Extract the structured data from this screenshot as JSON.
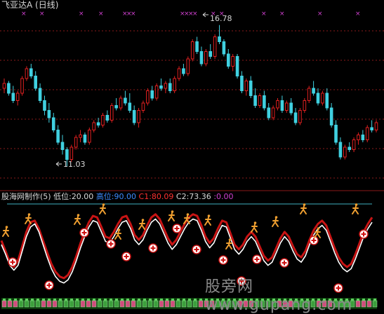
{
  "title": "飞亚达A (日线)",
  "indicator": {
    "name": "股海网制作(5)",
    "items": [
      {
        "label": "低位:",
        "value": "20.00",
        "color": "#d8d8d8"
      },
      {
        "label": "高位:",
        "value": "90.00",
        "color": "#3c8cff"
      },
      {
        "label": "C1:",
        "value": "80.09",
        "color": "#ff3030"
      },
      {
        "label": "C2:",
        "value": "73.36",
        "color": "#d8d8d8"
      },
      {
        "label": ":",
        "value": "0.00",
        "color": "#d040d0"
      }
    ]
  },
  "annotations": {
    "high": "16.78",
    "low": "11.03"
  },
  "watermark": "股旁网 www.gupang.com",
  "colors": {
    "background": "#000000",
    "up": "#e02020",
    "down": "#40d0e0",
    "grid": "#8a1a1a",
    "c1_line": "#c81414",
    "c2_line": "#ffffff",
    "marker": "#d040d0",
    "hline": "#40b0c0"
  },
  "chart_data": {
    "type": "candlestick",
    "price_high": 16.78,
    "price_low": 11.03,
    "candles": [
      [
        14.2,
        14.6,
        14.0,
        14.4
      ],
      [
        14.4,
        14.5,
        13.9,
        14.0
      ],
      [
        14.0,
        14.3,
        13.6,
        13.7
      ],
      [
        13.7,
        14.1,
        13.5,
        14.0
      ],
      [
        14.0,
        14.7,
        13.9,
        14.6
      ],
      [
        14.6,
        15.1,
        14.5,
        15.0
      ],
      [
        15.0,
        15.2,
        14.6,
        14.7
      ],
      [
        14.7,
        14.9,
        14.1,
        14.2
      ],
      [
        14.2,
        14.4,
        13.6,
        13.7
      ],
      [
        13.7,
        13.9,
        13.1,
        13.3
      ],
      [
        13.3,
        13.6,
        12.8,
        13.0
      ],
      [
        13.0,
        13.2,
        12.4,
        12.5
      ],
      [
        12.5,
        12.7,
        11.9,
        12.0
      ],
      [
        12.0,
        12.3,
        11.5,
        11.7
      ],
      [
        11.7,
        11.8,
        11.03,
        11.3
      ],
      [
        11.3,
        11.9,
        11.2,
        11.8
      ],
      [
        11.8,
        12.3,
        11.7,
        12.2
      ],
      [
        12.2,
        12.5,
        12.0,
        12.3
      ],
      [
        12.3,
        12.4,
        11.9,
        12.0
      ],
      [
        12.0,
        12.6,
        11.9,
        12.5
      ],
      [
        12.5,
        12.9,
        12.4,
        12.8
      ],
      [
        12.8,
        13.0,
        12.6,
        12.7
      ],
      [
        12.7,
        13.2,
        12.6,
        13.1
      ],
      [
        13.1,
        13.3,
        12.8,
        12.9
      ],
      [
        12.9,
        13.6,
        12.8,
        13.5
      ],
      [
        13.5,
        13.8,
        13.3,
        13.4
      ],
      [
        13.4,
        13.9,
        13.3,
        13.8
      ],
      [
        13.8,
        14.1,
        13.5,
        13.6
      ],
      [
        13.6,
        14.0,
        13.2,
        13.3
      ],
      [
        13.3,
        13.5,
        12.7,
        12.8
      ],
      [
        12.8,
        13.4,
        12.6,
        13.3
      ],
      [
        13.3,
        13.7,
        13.2,
        13.6
      ],
      [
        13.6,
        14.2,
        13.5,
        14.1
      ],
      [
        14.1,
        14.3,
        13.7,
        13.8
      ],
      [
        13.8,
        14.4,
        13.7,
        14.3
      ],
      [
        14.3,
        14.6,
        14.1,
        14.2
      ],
      [
        14.2,
        14.5,
        14.0,
        14.4
      ],
      [
        14.4,
        14.6,
        14.0,
        14.1
      ],
      [
        14.1,
        14.7,
        14.0,
        14.6
      ],
      [
        14.6,
        15.1,
        14.5,
        15.0
      ],
      [
        15.0,
        15.2,
        14.7,
        14.8
      ],
      [
        14.8,
        15.5,
        14.7,
        15.4
      ],
      [
        15.4,
        16.2,
        15.3,
        16.1
      ],
      [
        16.1,
        16.3,
        15.6,
        15.7
      ],
      [
        15.7,
        15.9,
        15.1,
        15.2
      ],
      [
        15.2,
        15.8,
        15.1,
        15.7
      ],
      [
        15.7,
        16.0,
        15.4,
        15.5
      ],
      [
        15.5,
        16.4,
        15.4,
        16.3
      ],
      [
        16.3,
        16.78,
        16.0,
        16.1
      ],
      [
        16.1,
        16.2,
        15.5,
        15.6
      ],
      [
        15.6,
        15.8,
        15.0,
        15.1
      ],
      [
        15.1,
        15.6,
        14.9,
        15.5
      ],
      [
        15.5,
        15.6,
        14.6,
        14.7
      ],
      [
        14.7,
        14.9,
        14.0,
        14.1
      ],
      [
        14.1,
        14.6,
        13.9,
        14.5
      ],
      [
        14.5,
        14.7,
        13.8,
        13.9
      ],
      [
        13.9,
        14.2,
        13.4,
        13.5
      ],
      [
        13.5,
        14.0,
        13.4,
        13.9
      ],
      [
        13.9,
        14.1,
        13.3,
        13.4
      ],
      [
        13.4,
        13.6,
        12.9,
        13.0
      ],
      [
        13.0,
        13.5,
        12.9,
        13.4
      ],
      [
        13.4,
        13.8,
        13.3,
        13.7
      ],
      [
        13.7,
        13.9,
        13.2,
        13.3
      ],
      [
        13.3,
        13.7,
        13.2,
        13.6
      ],
      [
        13.6,
        13.8,
        13.1,
        13.2
      ],
      [
        13.2,
        13.4,
        12.7,
        12.8
      ],
      [
        12.8,
        13.4,
        12.7,
        13.3
      ],
      [
        13.3,
        13.8,
        13.2,
        13.7
      ],
      [
        13.7,
        14.3,
        13.6,
        14.2
      ],
      [
        14.2,
        14.5,
        13.9,
        14.0
      ],
      [
        14.0,
        14.2,
        13.5,
        13.6
      ],
      [
        13.6,
        14.1,
        13.5,
        14.0
      ],
      [
        14.0,
        14.2,
        13.3,
        13.4
      ],
      [
        13.4,
        13.6,
        12.6,
        12.7
      ],
      [
        12.7,
        12.9,
        11.9,
        12.0
      ],
      [
        12.0,
        12.2,
        11.3,
        11.4
      ],
      [
        11.4,
        11.9,
        11.3,
        11.8
      ],
      [
        11.8,
        12.0,
        11.6,
        11.7
      ],
      [
        11.7,
        12.2,
        11.6,
        12.1
      ],
      [
        12.1,
        12.4,
        11.9,
        12.3
      ],
      [
        12.3,
        12.5,
        12.0,
        12.1
      ],
      [
        12.1,
        12.7,
        12.0,
        12.6
      ],
      [
        12.6,
        12.9,
        12.4,
        12.5
      ],
      [
        12.5,
        12.9,
        12.4,
        12.8
      ]
    ],
    "oscillator_c1": [
      55,
      42,
      28,
      22,
      30,
      48,
      66,
      78,
      80,
      70,
      55,
      40,
      26,
      16,
      10,
      8,
      12,
      22,
      36,
      52,
      66,
      78,
      86,
      84,
      72,
      60,
      58,
      66,
      76,
      84,
      86,
      76,
      62,
      56,
      62,
      74,
      84,
      88,
      82,
      70,
      58,
      50,
      56,
      66,
      76,
      84,
      88,
      86,
      74,
      60,
      52,
      58,
      70,
      80,
      78,
      64,
      50,
      44,
      50,
      60,
      66,
      60,
      48,
      36,
      30,
      34,
      46,
      58,
      66,
      60,
      48,
      38,
      34,
      42,
      56,
      68,
      76,
      80,
      74,
      60,
      46,
      34,
      26,
      22,
      26,
      38,
      52,
      66,
      76,
      84
    ],
    "oscillator_c2": [
      50,
      38,
      24,
      18,
      24,
      42,
      60,
      72,
      76,
      66,
      50,
      34,
      20,
      10,
      4,
      2,
      6,
      16,
      30,
      46,
      60,
      72,
      80,
      78,
      66,
      54,
      52,
      60,
      70,
      78,
      80,
      70,
      56,
      50,
      56,
      68,
      78,
      82,
      76,
      64,
      52,
      44,
      50,
      60,
      70,
      78,
      82,
      80,
      68,
      54,
      46,
      52,
      64,
      74,
      72,
      58,
      44,
      38,
      44,
      54,
      60,
      54,
      42,
      30,
      24,
      28,
      40,
      52,
      60,
      54,
      42,
      32,
      28,
      36,
      50,
      62,
      70,
      74,
      68,
      54,
      40,
      28,
      20,
      16,
      20,
      32,
      46,
      60,
      70,
      78
    ]
  }
}
